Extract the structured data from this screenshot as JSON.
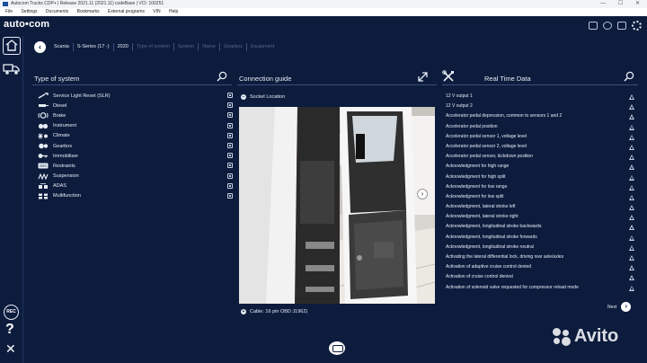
{
  "window": {
    "title": "Autocom Trucks CDP+  |  Release 2021.11 (2021.11) codeBase  |  VCI: 100251",
    "controls": "— ☐ ✕"
  },
  "menu": [
    "File",
    "Settings",
    "Documents",
    "Bookmarks",
    "External programs",
    "VIN",
    "Help"
  ],
  "app": {
    "logo": "auto•com"
  },
  "rail": {
    "rec_label": "REC",
    "help_glyph": "?",
    "close_glyph": "✕"
  },
  "breadcrumb": {
    "back_glyph": "‹",
    "items": [
      {
        "label": "Scania",
        "state": "active"
      },
      {
        "label": "S-Series (17 -)",
        "state": "active"
      },
      {
        "label": "2020",
        "state": "active"
      },
      {
        "label": "Type of system",
        "state": "dim"
      },
      {
        "label": "System",
        "state": "dim"
      },
      {
        "label": "Name",
        "state": "dim"
      },
      {
        "label": "Gearbox",
        "state": "dim"
      },
      {
        "label": "Equipment",
        "state": "dim"
      }
    ]
  },
  "type_of_system": {
    "title": "Type of system",
    "items": [
      {
        "label": "Service Light Reset (SLR)",
        "icon": "wrench-icon"
      },
      {
        "label": "Diesel",
        "icon": "fuel-injector-icon"
      },
      {
        "label": "Brake",
        "icon": "brake-icon"
      },
      {
        "label": "Instrument",
        "icon": "instrument-icon"
      },
      {
        "label": "Climate",
        "icon": "climate-icon"
      },
      {
        "label": "Gearbox",
        "icon": "gearbox-icon"
      },
      {
        "label": "Immobiliser",
        "icon": "key-icon"
      },
      {
        "label": "Restraints",
        "icon": "airbag-icon"
      },
      {
        "label": "Suspension",
        "icon": "suspension-icon"
      },
      {
        "label": "ADAS",
        "icon": "adas-icon"
      },
      {
        "label": "Multifunction",
        "icon": "multifunction-icon"
      }
    ]
  },
  "connection_guide": {
    "title": "Connection guide",
    "socket_label": "Socket Location",
    "cable_label": "Cable: 16 pin OBD J1962)",
    "next_glyph": "›"
  },
  "real_time_data": {
    "title": "Real Time Data",
    "items": [
      "12 V output 1",
      "12 V output 2",
      "Accelerator pedal depression, common to sensors 1 and 2",
      "Accelerator pedal position",
      "Accelerator pedal sensor 1, voltage level",
      "Accelerator pedal sensor 2, voltage level",
      "Accelerator pedal sensor, kickdown position",
      "Acknowledgment for high range",
      "Acknowledgment for high split",
      "Acknowledgment for low range",
      "Acknowledgment for low split",
      "Acknowledgment, lateral stroke left",
      "Acknowledgment, lateral stroke right",
      "Acknowledgment, longitudinal stroke backwards",
      "Acknowledgment, longitudinal stroke forwards",
      "Acknowledgment, longitudinal stroke neutral",
      "Activating the lateral differential lock, driving rear axle/axles",
      "Activation of adaptive cruise control denied",
      "Activation of cruise control denied",
      "Activation of solenoid valve requested for compressor reload mode"
    ],
    "next_label": "Next",
    "next_glyph": "›"
  },
  "watermark": {
    "text": "Avito"
  }
}
